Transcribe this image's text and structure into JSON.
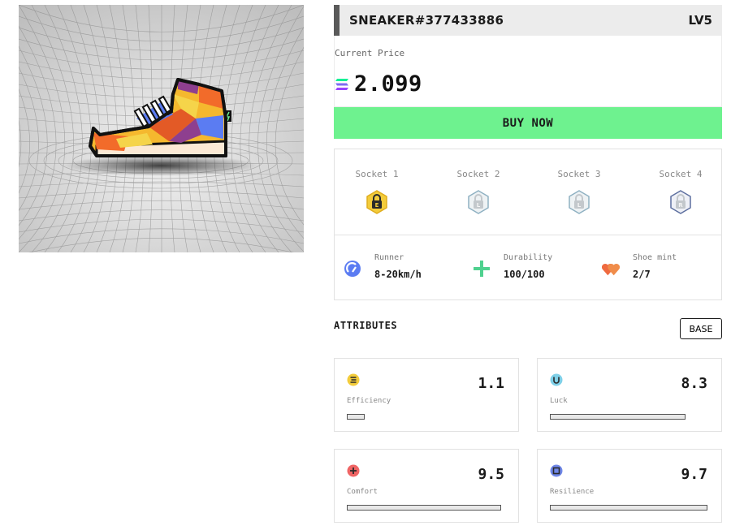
{
  "nft": {
    "title": "SNEAKER#377433886",
    "level": "LV5"
  },
  "price": {
    "label": "Current Price",
    "value": "2.099",
    "currency_icon": "solana-icon"
  },
  "buy_label": "BUY NOW",
  "sockets": [
    {
      "label": "Socket 1",
      "icon": "lock-icon",
      "color": "#f3cc3b",
      "letter": ""
    },
    {
      "label": "Socket 2",
      "icon": "lock-icon",
      "color": "#9fb8c4",
      "letter": "L"
    },
    {
      "label": "Socket 3",
      "icon": "lock-icon",
      "color": "#9fb8c4",
      "letter": "L"
    },
    {
      "label": "Socket 4",
      "icon": "lock-icon",
      "color": "#5d6f9f",
      "letter": "R"
    }
  ],
  "stats": [
    {
      "label": "Runner",
      "value": "8-20km/h",
      "icon": "runner-icon",
      "color": "#5b7cf2"
    },
    {
      "label": "Durability",
      "value": "100/100",
      "icon": "plus-icon",
      "color": "#4fd18f"
    },
    {
      "label": "Shoe mint",
      "value": "2/7",
      "icon": "hearts-icon",
      "color": "#ef6a3f"
    }
  ],
  "attributes_heading": "ATTRIBUTES",
  "base_label": "BASE",
  "attributes": [
    {
      "label": "Efficiency",
      "value": "1.1",
      "fraction": 0.1,
      "icon": "efficiency-icon",
      "color": "#f3cc3b"
    },
    {
      "label": "Luck",
      "value": "8.3",
      "fraction": 0.86,
      "icon": "luck-icon",
      "color": "#7fd0e8"
    },
    {
      "label": "Comfort",
      "value": "9.5",
      "fraction": 0.98,
      "icon": "comfort-icon",
      "color": "#ef6464"
    },
    {
      "label": "Resilience",
      "value": "9.7",
      "fraction": 1.0,
      "icon": "resilience-icon",
      "color": "#6f87e8"
    }
  ]
}
